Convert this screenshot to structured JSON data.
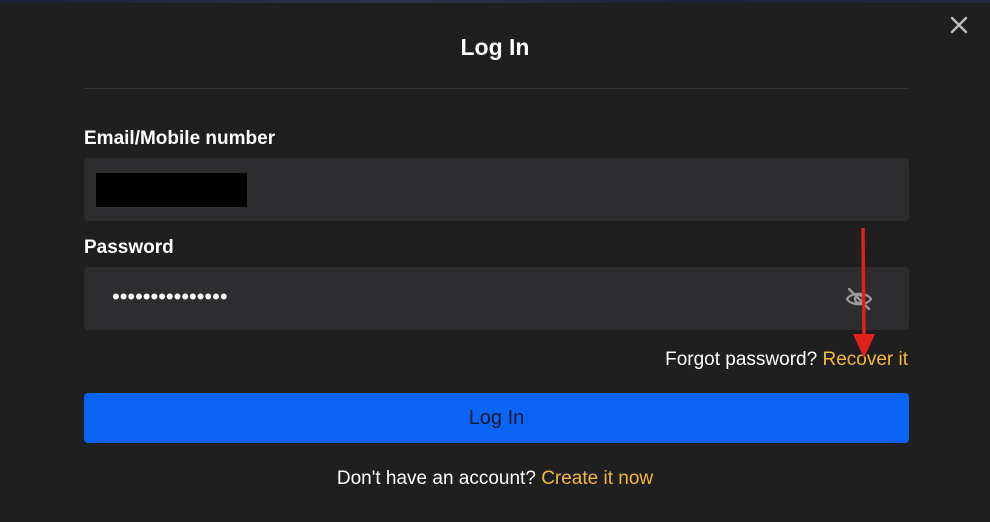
{
  "modal": {
    "title": "Log In",
    "close_icon": "close-icon"
  },
  "form": {
    "email_label": "Email/Mobile number",
    "email_value": "",
    "password_label": "Password",
    "password_value": "•••••••••••••••",
    "visibility_icon": "eye-slash-icon"
  },
  "forgot": {
    "text": "Forgot password?",
    "link": "Recover it"
  },
  "login_button": "Log In",
  "signup": {
    "text": "Don't have an account?",
    "link": "Create it now"
  },
  "annotation": {
    "arrow_color": "#e0201b"
  },
  "colors": {
    "background": "#1f1f20",
    "field": "#2d2d2f",
    "primary": "#0a64f5",
    "link": "#f5b73b"
  }
}
